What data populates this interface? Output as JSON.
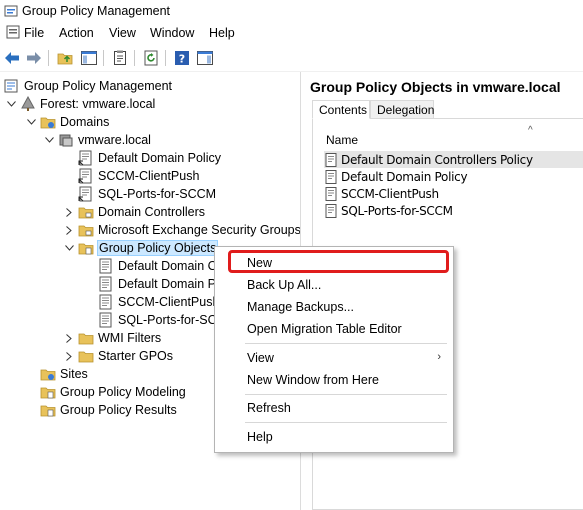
{
  "window": {
    "title": "Group Policy Management"
  },
  "menubar": {
    "items": [
      "File",
      "Action",
      "View",
      "Window",
      "Help"
    ]
  },
  "tree": {
    "root": "Group Policy Management",
    "forest": "Forest: vmware.local",
    "domains": "Domains",
    "domain": "vmware.local",
    "links": [
      "Default Domain Policy",
      "SCCM-ClientPush",
      "SQL-Ports-for-SCCM"
    ],
    "domain_controllers": "Domain Controllers",
    "exchange_groups": "Microsoft Exchange Security Groups",
    "gpo_container": "Group Policy Objects",
    "gpo_items": [
      "Default Domain C",
      "Default Domain P",
      "SCCM-ClientPush",
      "SQL-Ports-for-SC"
    ],
    "wmi_filters": "WMI Filters",
    "starter_gpos": "Starter GPOs",
    "sites": "Sites",
    "modeling": "Group Policy Modeling",
    "results": "Group Policy Results"
  },
  "right_pane": {
    "header": "Group Policy Objects in vmware.local",
    "tabs": [
      "Contents",
      "Delegation"
    ],
    "column_name": "Name",
    "rows": [
      "Default Domain Controllers Policy",
      "Default Domain Policy",
      "SCCM-ClientPush",
      "SQL-Ports-for-SCCM"
    ]
  },
  "context_menu": {
    "items": [
      "New",
      "Back Up All...",
      "Manage Backups...",
      "Open Migration Table Editor",
      "View",
      "New Window from Here",
      "Refresh",
      "Help"
    ]
  },
  "colors": {
    "highlight": "#e01c1c",
    "selection": "#cce8ff",
    "folder": "#e8c25a"
  }
}
